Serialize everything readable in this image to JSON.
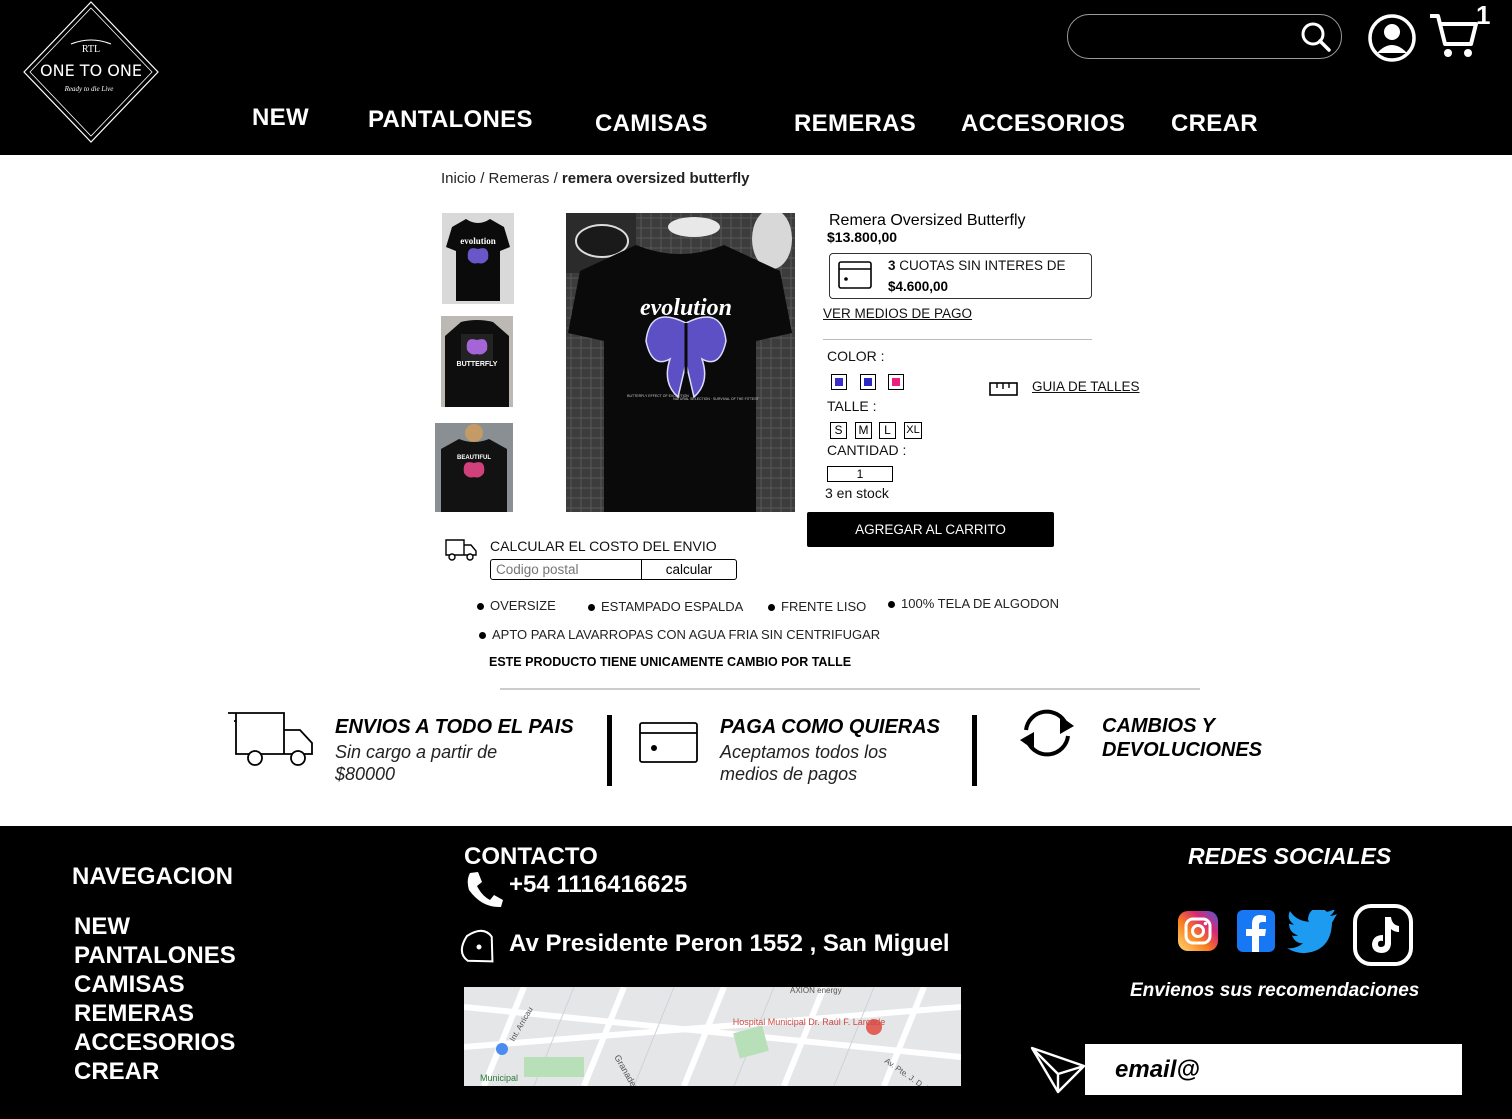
{
  "header": {
    "logo": {
      "line1": "RTL",
      "brand": "ONE TO ONE",
      "tagline": "Ready to die Live"
    },
    "nav": [
      "NEW",
      "PANTALONES",
      "CAMISAS",
      "REMERAS",
      "ACCESORIOS",
      "CREAR"
    ],
    "search": {
      "placeholder": ""
    },
    "cart_count": "1"
  },
  "breadcrumb": {
    "home": "Inicio",
    "sep1": " / ",
    "category": "Remeras",
    "sep2": " / ",
    "current": "remera oversized butterfly"
  },
  "gallery": {
    "thumbs": [
      {
        "word": "evolution",
        "bg": "#000000",
        "wing": "#6a56c8"
      },
      {
        "word": "BUTTERFLY",
        "bg": "#111111",
        "wing": "#a565d6"
      },
      {
        "word": "BEAUTIFUL",
        "bg": "#1a1a1a",
        "wing": "#d0407a"
      }
    ],
    "main_word": "evolution",
    "main_caption1": "BUTTERFLY EFFECT OF EVOLUTION",
    "main_caption2": "NATURAL SELECTION · SURVIVAL OF THE FITTEST"
  },
  "product": {
    "name": "Remera Oversized Butterfly",
    "price": "$13.800,00",
    "installments": {
      "count": "3",
      "text": " CUOTAS SIN INTERES DE",
      "amount": "$4.600,00"
    },
    "payment_link": "VER MEDIOS DE PAGO",
    "color_label": "COLOR :",
    "colors": [
      "#3b2ec7",
      "#2a2ac0",
      "#e8207f"
    ],
    "size_label": "TALLE :",
    "sizes": [
      "S",
      "M",
      "L",
      "XL"
    ],
    "size_guide": "GUIA DE TALLES",
    "qty_label": "CANTIDAD :",
    "qty_value": "1",
    "stock": "3 en stock",
    "add_to_cart": "AGREGAR AL CARRITO"
  },
  "shipping": {
    "label": "CALCULAR EL COSTO DEL ENVIO",
    "placeholder": "Codigo postal",
    "button": "calcular"
  },
  "features": [
    "OVERSIZE",
    "ESTAMPADO ESPALDA",
    "FRENTE LISO",
    "100% TELA DE ALGODON",
    "APTO PARA LAVARROPAS CON AGUA FRIA SIN CENTRIFUGAR"
  ],
  "exchange_note": "ESTE PRODUCTO TIENE UNICAMENTE CAMBIO POR TALLE",
  "benefits": [
    {
      "title": "ENVIOS A TODO EL PAIS",
      "sub": "Sin cargo a partir de $80000"
    },
    {
      "title": "PAGA COMO QUIERAS",
      "sub": "Aceptamos todos los medios de pagos"
    },
    {
      "title": "CAMBIOS Y DEVOLUCIONES",
      "sub": ""
    }
  ],
  "footer": {
    "nav_title": "NAVEGACION",
    "nav": [
      "NEW",
      "PANTALONES",
      "CAMISAS",
      "REMERAS",
      "ACCESORIOS",
      "CREAR"
    ],
    "contact_title": "CONTACTO",
    "phone": "+54 1116416625",
    "address": "Av Presidente Peron 1552 , San Miguel",
    "map_labels": {
      "poi": "Hospital Municipal Dr. Raúl F. Larcade",
      "street1": "Granaderos A Caballo",
      "street2": "Int. Arricau",
      "street3": "Av. Pte. J. D. P.",
      "place": "Municipal",
      "energy": "AXION energy"
    },
    "social_title": "REDES SOCIALES",
    "newsletter_text": "Envienos sus recomendaciones",
    "email_placeholder": "email@"
  },
  "colors": {
    "brand": "#000000",
    "instagram": "#e1306c",
    "facebook": "#1877f2",
    "twitter": "#1d9bf0"
  }
}
